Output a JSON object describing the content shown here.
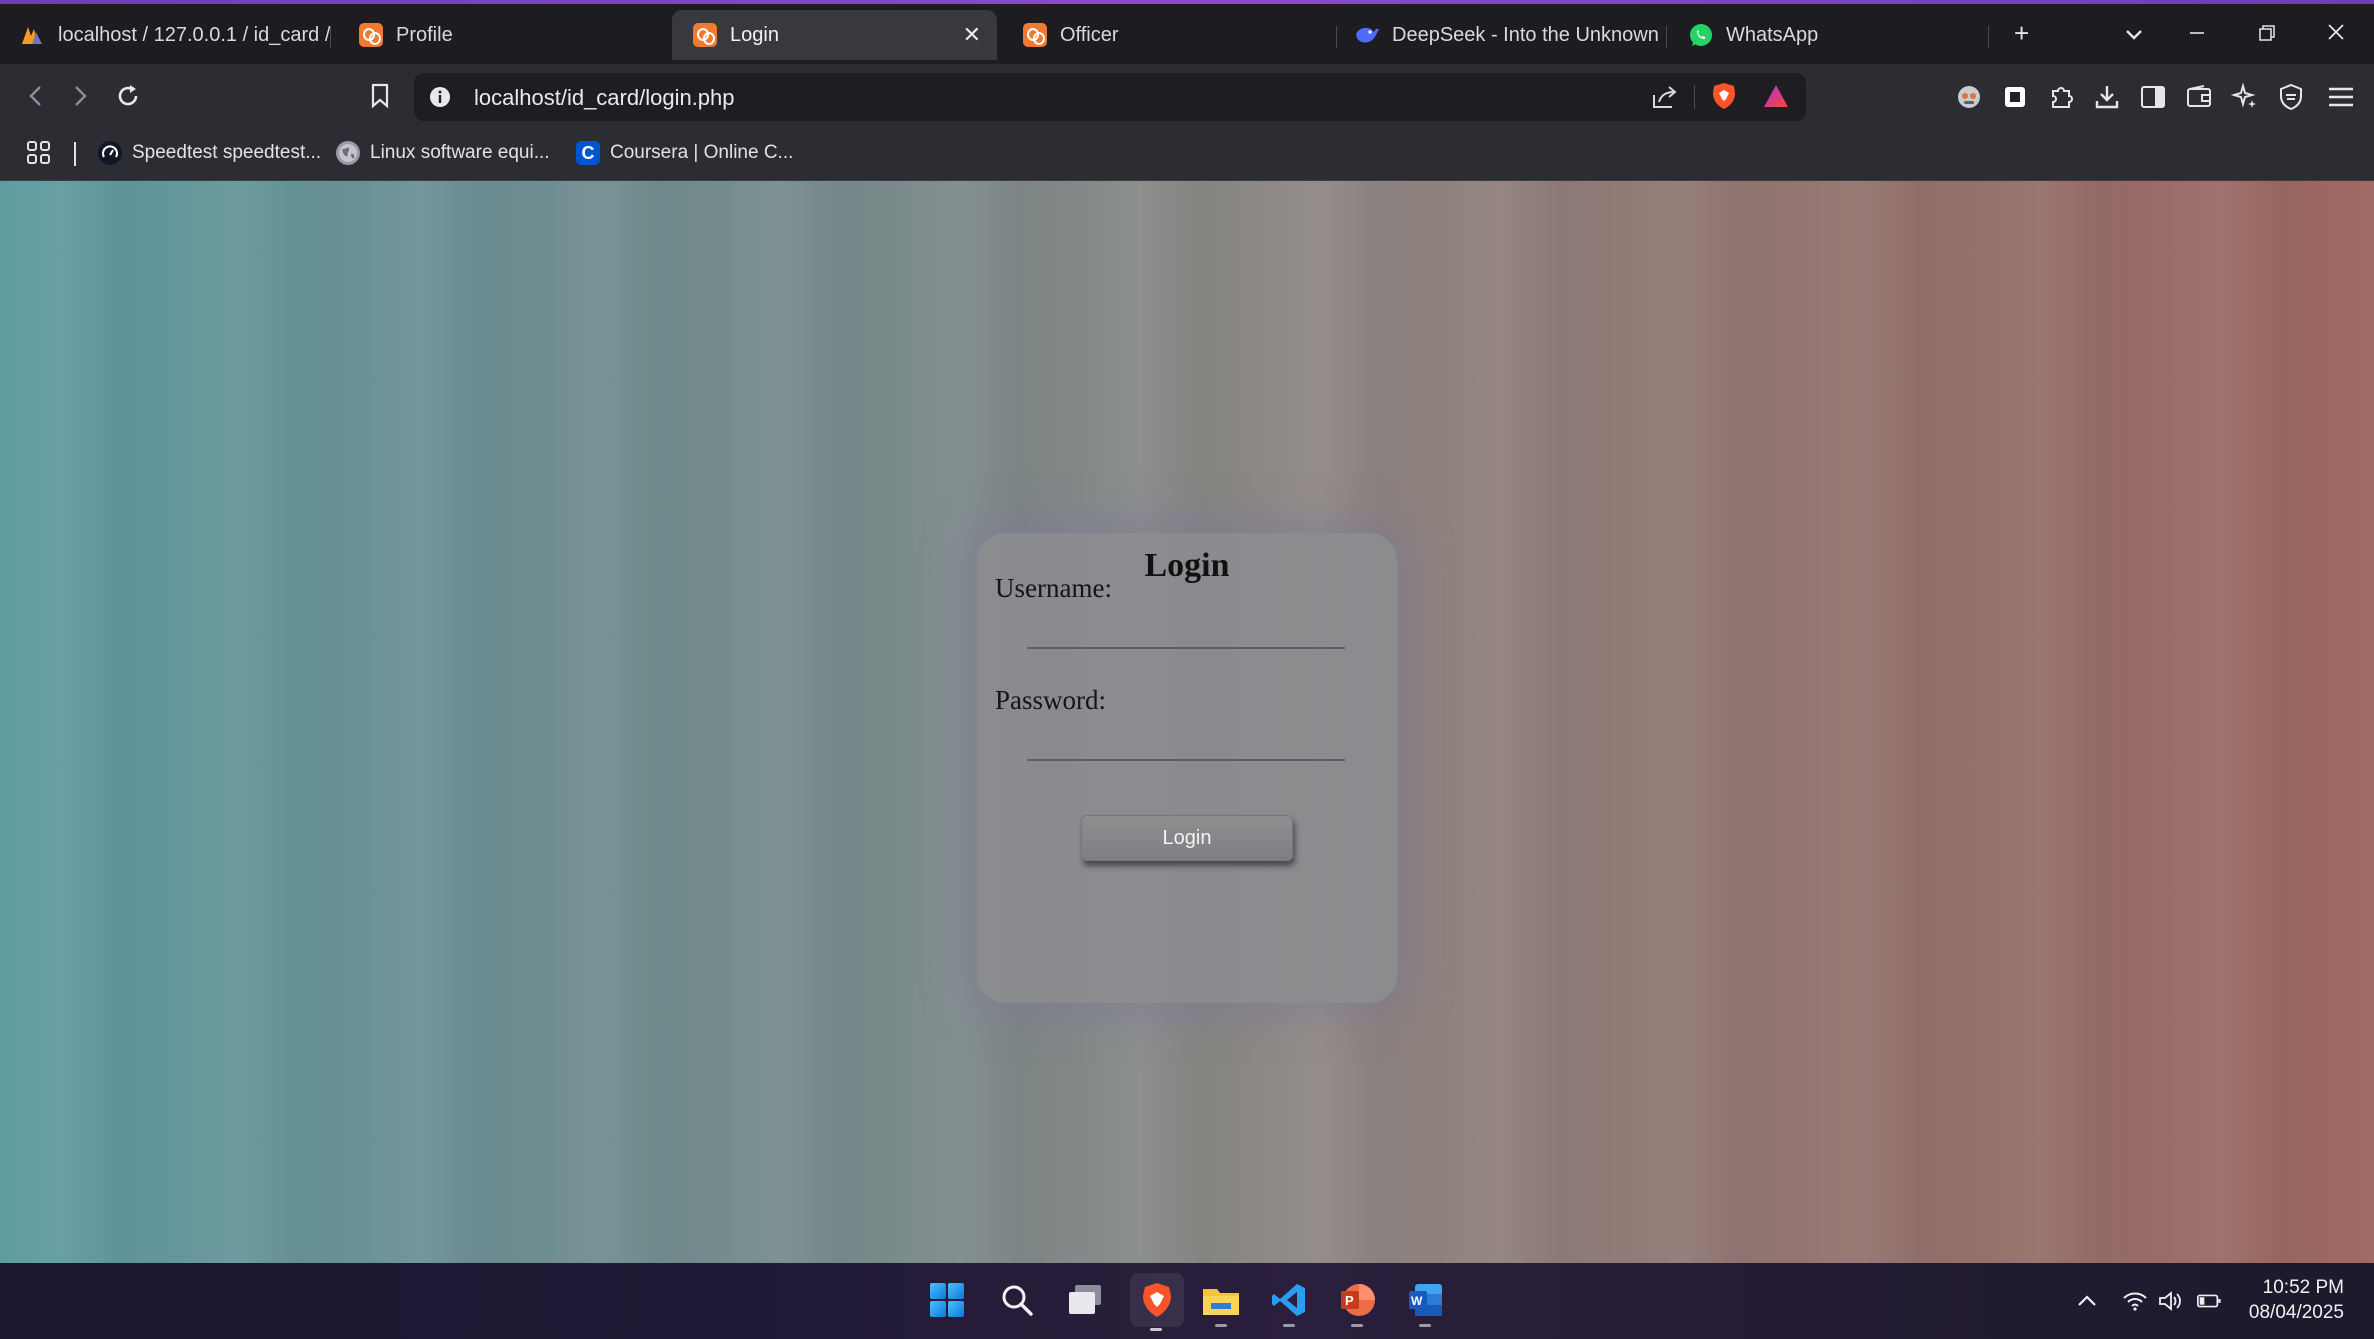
{
  "browser": {
    "tabs": [
      {
        "title": "localhost / 127.0.0.1 / id_card /",
        "icon": "phpmyadmin-icon"
      },
      {
        "title": "Profile",
        "icon": "xampp-icon"
      },
      {
        "title": "Login",
        "icon": "xampp-icon",
        "active": true
      },
      {
        "title": "Officer",
        "icon": "xampp-icon"
      },
      {
        "title": "DeepSeek - Into the Unknown",
        "icon": "deepseek-icon"
      },
      {
        "title": "WhatsApp",
        "icon": "whatsapp-icon"
      }
    ],
    "url": "localhost/id_card/login.php",
    "bookmarks": [
      {
        "title": "Speedtest speedtest...",
        "icon": "speedtest-icon"
      },
      {
        "title": "Linux software equi...",
        "icon": "globe-icon"
      },
      {
        "title": "Coursera | Online C...",
        "icon": "coursera-icon"
      }
    ],
    "accent_color": "#7c44c6"
  },
  "login": {
    "title": "Login",
    "username_label": "Username:",
    "username_value": "",
    "password_label": "Password:",
    "password_value": "",
    "button_label": "Login"
  },
  "taskbar": {
    "time": "10:52 PM",
    "date": "08/04/2025"
  }
}
